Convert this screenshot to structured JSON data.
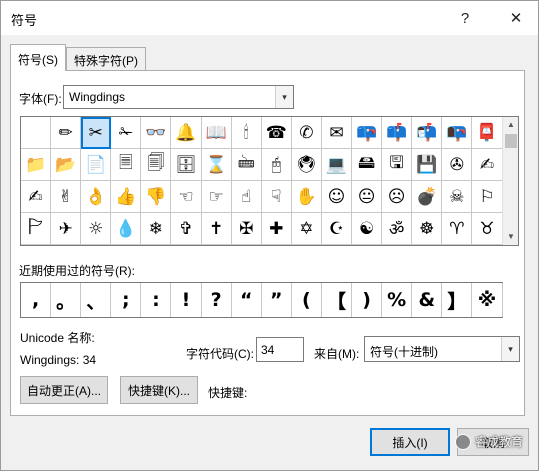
{
  "window": {
    "title": "符号",
    "help_glyph": "?",
    "close_glyph": "✕"
  },
  "tabs": [
    {
      "label": "符号(S)",
      "active": true
    },
    {
      "label": "特殊字符(P)",
      "active": false
    }
  ],
  "font": {
    "label": "字体(F):",
    "value": "Wingdings"
  },
  "symbol_grid": {
    "selected_index": 2,
    "rows": [
      [
        "",
        "✏",
        "✂",
        "✁",
        "👓",
        "🔔",
        "📖",
        "🕯",
        "☎",
        "✆",
        "✉",
        "📪",
        "📫",
        "📬",
        "📭",
        "📮"
      ],
      [
        "📁",
        "📂",
        "📄",
        "🗏",
        "🗐",
        "🗄",
        "⌛",
        "🖮",
        "🖰",
        "🖲",
        "💻",
        "🖴",
        "🖫",
        "💾",
        "✇",
        "✍"
      ],
      [
        "✍",
        "✌",
        "👌",
        "👍",
        "👎",
        "☜",
        "☞",
        "☝",
        "☟",
        "✋",
        "☺",
        "😐",
        "☹",
        "💣",
        "☠",
        "⚐"
      ],
      [
        "🏱",
        "✈",
        "☼",
        "💧",
        "❄",
        "✞",
        "✝",
        "✠",
        "✚",
        "✡",
        "☪",
        "☯",
        "ॐ",
        "☸",
        "♈",
        "♉"
      ]
    ]
  },
  "recent": {
    "label": "近期使用过的符号(R):",
    "symbols": [
      ",",
      "。",
      "、",
      ";",
      ":",
      "!",
      "?",
      "“",
      "”",
      "(",
      "【",
      ")",
      "%",
      "&",
      "】",
      "※"
    ]
  },
  "unicode_name": {
    "label": "Unicode 名称:",
    "font_code": "Wingdings: 34"
  },
  "char_code": {
    "label": "字符代码(C):",
    "value": "34"
  },
  "from": {
    "label": "来自(M):",
    "value": "符号(十进制)"
  },
  "buttons": {
    "autocorrect": "自动更正(A)...",
    "shortcut_key": "快捷键(K)...",
    "shortcut_text": "快捷键:",
    "insert": "插入(I)",
    "cancel": "取消"
  },
  "watermark": {
    "text": "睿成教育"
  },
  "icons": {
    "dropdown": "▾",
    "scroll_up": "▲",
    "scroll_down": "▼"
  }
}
